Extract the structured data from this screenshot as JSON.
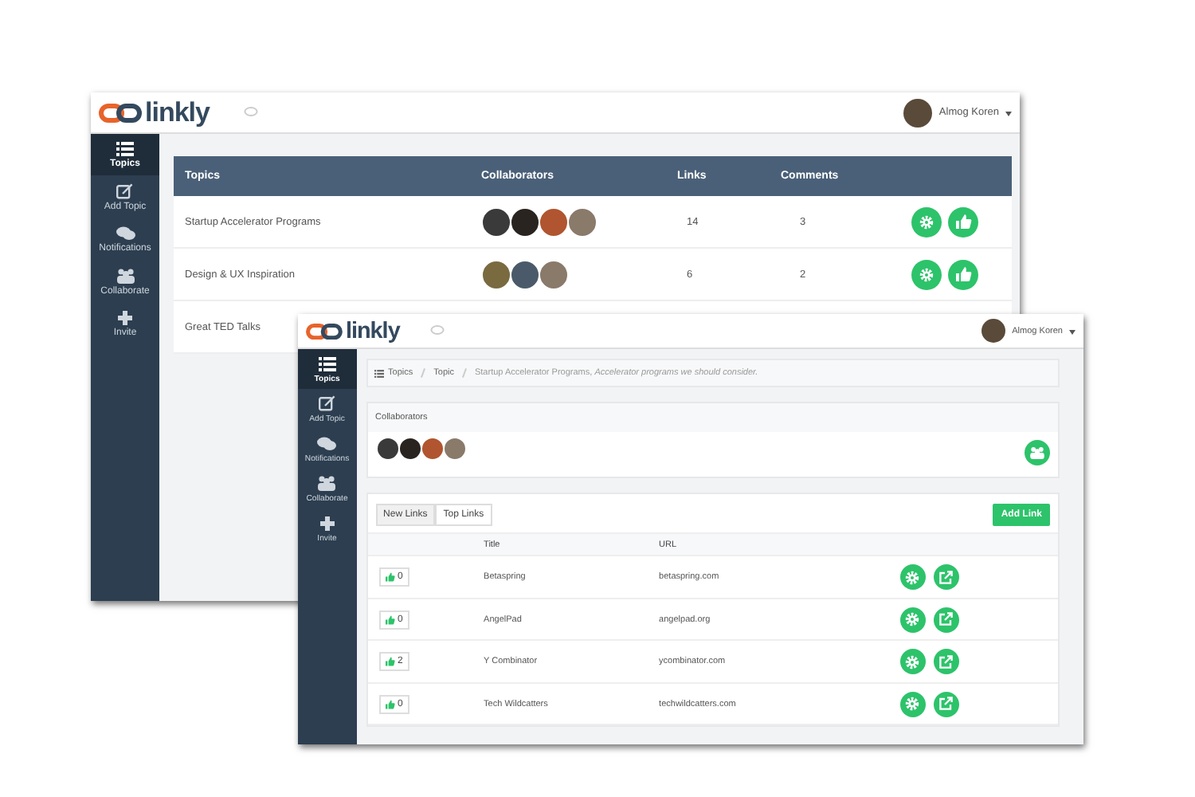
{
  "windows": [
    {
      "kind": "topics",
      "brand": "linkly",
      "user": "Almog Koren",
      "nav": [
        {
          "label": "Topics",
          "selected": true
        },
        {
          "label": "Add Topic",
          "selected": false
        },
        {
          "label": "Notifications",
          "selected": false
        },
        {
          "label": "Collaborate",
          "selected": false
        },
        {
          "label": "Invite",
          "selected": false
        }
      ],
      "table": {
        "columns": [
          "Topics",
          "Collaborators",
          "Links",
          "Comments"
        ],
        "rows": [
          {
            "topic": "Startup Accelerator Programs",
            "collaborators": [
              {
                "color": "#3a3a3a"
              },
              {
                "color": "#2a2420"
              },
              {
                "color": "#b0552f"
              },
              {
                "color": "#8a7a6a"
              }
            ],
            "links": "14",
            "comments": "3"
          },
          {
            "topic": "Design & UX Inspiration",
            "collaborators": [
              {
                "color": "#7a6a40"
              },
              {
                "color": "#4a5a6a"
              },
              {
                "color": "#8a7a6a"
              }
            ],
            "links": "6",
            "comments": "2"
          },
          {
            "topic": "Great TED Talks"
          }
        ]
      }
    },
    {
      "kind": "topic",
      "brand": "linkly",
      "user": "Almog Koren",
      "nav": [
        {
          "label": "Topics",
          "selected": true
        },
        {
          "label": "Add Topic",
          "selected": false
        },
        {
          "label": "Notifications",
          "selected": false
        },
        {
          "label": "Collaborate",
          "selected": false
        },
        {
          "label": "Invite",
          "selected": false
        }
      ],
      "breadcrumb": [
        "Topics",
        "Topic",
        "Startup Accelerator Programs, *Accelerator programs we should consider.*"
      ],
      "collaborators_title": "Collaborators",
      "collaborators": [
        {
          "color": "#3a3a3a"
        },
        {
          "color": "#2a2420"
        },
        {
          "color": "#b0552f"
        },
        {
          "color": "#8a7a6a"
        }
      ],
      "tabs": [
        {
          "label": "New Links",
          "selected": true
        },
        {
          "label": "Top Links",
          "selected": false
        }
      ],
      "add_button": "Add Link",
      "table": {
        "columns": {
          "title": "Title",
          "url": "URL"
        },
        "rows": [
          {
            "votes": "0",
            "title": "Betaspring",
            "url": "betaspring.com"
          },
          {
            "votes": "0",
            "title": "AngelPad",
            "url": "angelpad.org"
          },
          {
            "votes": "2",
            "title": "Y Combinator",
            "url": "ycombinator.com"
          },
          {
            "votes": "0",
            "title": "Tech Wildcatters",
            "url": "techwildcatters.com"
          }
        ]
      }
    }
  ]
}
